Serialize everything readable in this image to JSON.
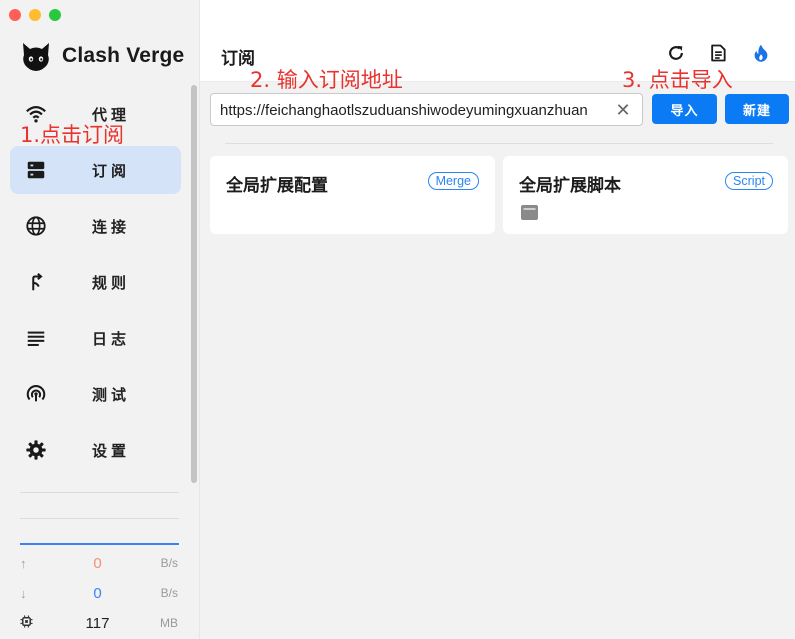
{
  "app": {
    "name": "Clash Verge"
  },
  "sidebar": {
    "items": [
      {
        "label": "代理",
        "icon": "wifi-icon",
        "active": false
      },
      {
        "label": "订阅",
        "icon": "storage-icon",
        "active": true
      },
      {
        "label": "连接",
        "icon": "globe-icon",
        "active": false
      },
      {
        "label": "规则",
        "icon": "fork-arrow-icon",
        "active": false
      },
      {
        "label": "日志",
        "icon": "list-lines-icon",
        "active": false
      },
      {
        "label": "测试",
        "icon": "radar-icon",
        "active": false
      },
      {
        "label": "设置",
        "icon": "gear-icon",
        "active": false
      }
    ],
    "traffic": {
      "upload": {
        "value": "0",
        "unit": "B/s",
        "icon": "arrow-up-icon"
      },
      "download": {
        "value": "0",
        "unit": "B/s",
        "icon": "arrow-down-icon"
      },
      "memory": {
        "value": "117",
        "unit": "MB",
        "icon": "memory-chip-icon"
      }
    }
  },
  "header": {
    "title": "订阅",
    "actions": [
      "refresh-icon",
      "document-icon",
      "fire-icon"
    ]
  },
  "subscription": {
    "url_value": "https://feichanghaotlszuduanshiwodeyumingxuanzhuan",
    "import_label": "导入",
    "new_label": "新建"
  },
  "cards": [
    {
      "title": "全局扩展配置",
      "badge": "Merge"
    },
    {
      "title": "全局扩展脚本",
      "badge": "Script",
      "icon": "file-icon"
    }
  ],
  "annotations": {
    "step1": "1.点击订阅",
    "step2": "2. 输入订阅地址",
    "step3": "3. 点击导入"
  },
  "colors": {
    "accent": "#0a7bf5",
    "active_nav": "#d4e3f7",
    "annotation": "#e8332e",
    "upload": "#f29074",
    "download": "#3b82f6"
  }
}
